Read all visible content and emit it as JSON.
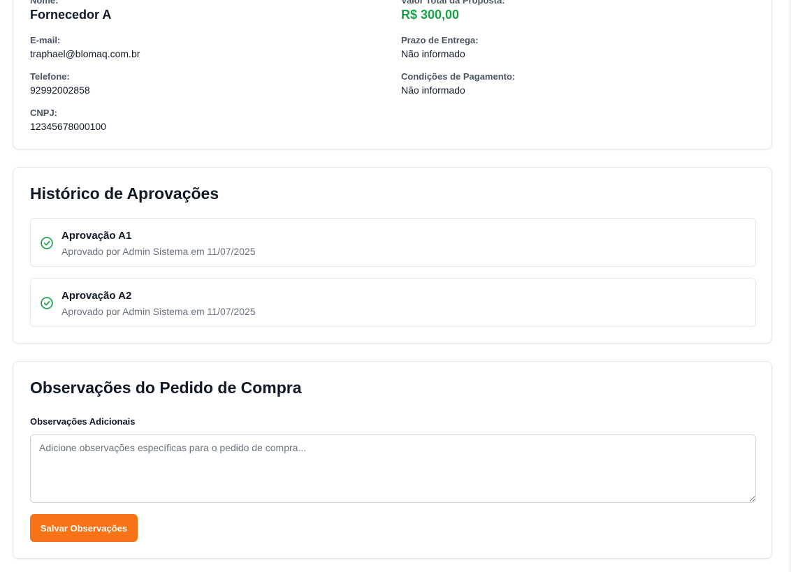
{
  "supplier": {
    "name_label": "Nome:",
    "name": "Fornecedor A",
    "email_label": "E-mail:",
    "email": "traphael@blomaq.com.br",
    "phone_label": "Telefone:",
    "phone": "92992002858",
    "cnpj_label": "CNPJ:",
    "cnpj": "12345678000100",
    "total_label": "Valor Total da Proposta:",
    "total": "R$ 300,00",
    "delivery_label": "Prazo de Entrega:",
    "delivery": "Não informado",
    "payment_label": "Condições de Pagamento:",
    "payment": "Não informado"
  },
  "history": {
    "title": "Histórico de Aprovações",
    "items": [
      {
        "title": "Aprovação A1",
        "detail": "Aprovado por Admin Sistema em 11/07/2025",
        "icon": "check-circle-icon"
      },
      {
        "title": "Aprovação A2",
        "detail": "Aprovado por Admin Sistema em 11/07/2025",
        "icon": "check-circle-icon"
      }
    ]
  },
  "notes": {
    "title": "Observações do Pedido de Compra",
    "field_label": "Observações Adicionais",
    "placeholder": "Adicione observações específicas para o pedido de compra...",
    "value": "",
    "save_label": "Salvar Observações"
  },
  "colors": {
    "accent": "#f97316",
    "success": "#16a34a",
    "border": "#e5e7eb",
    "muted_text": "#6b7280"
  }
}
